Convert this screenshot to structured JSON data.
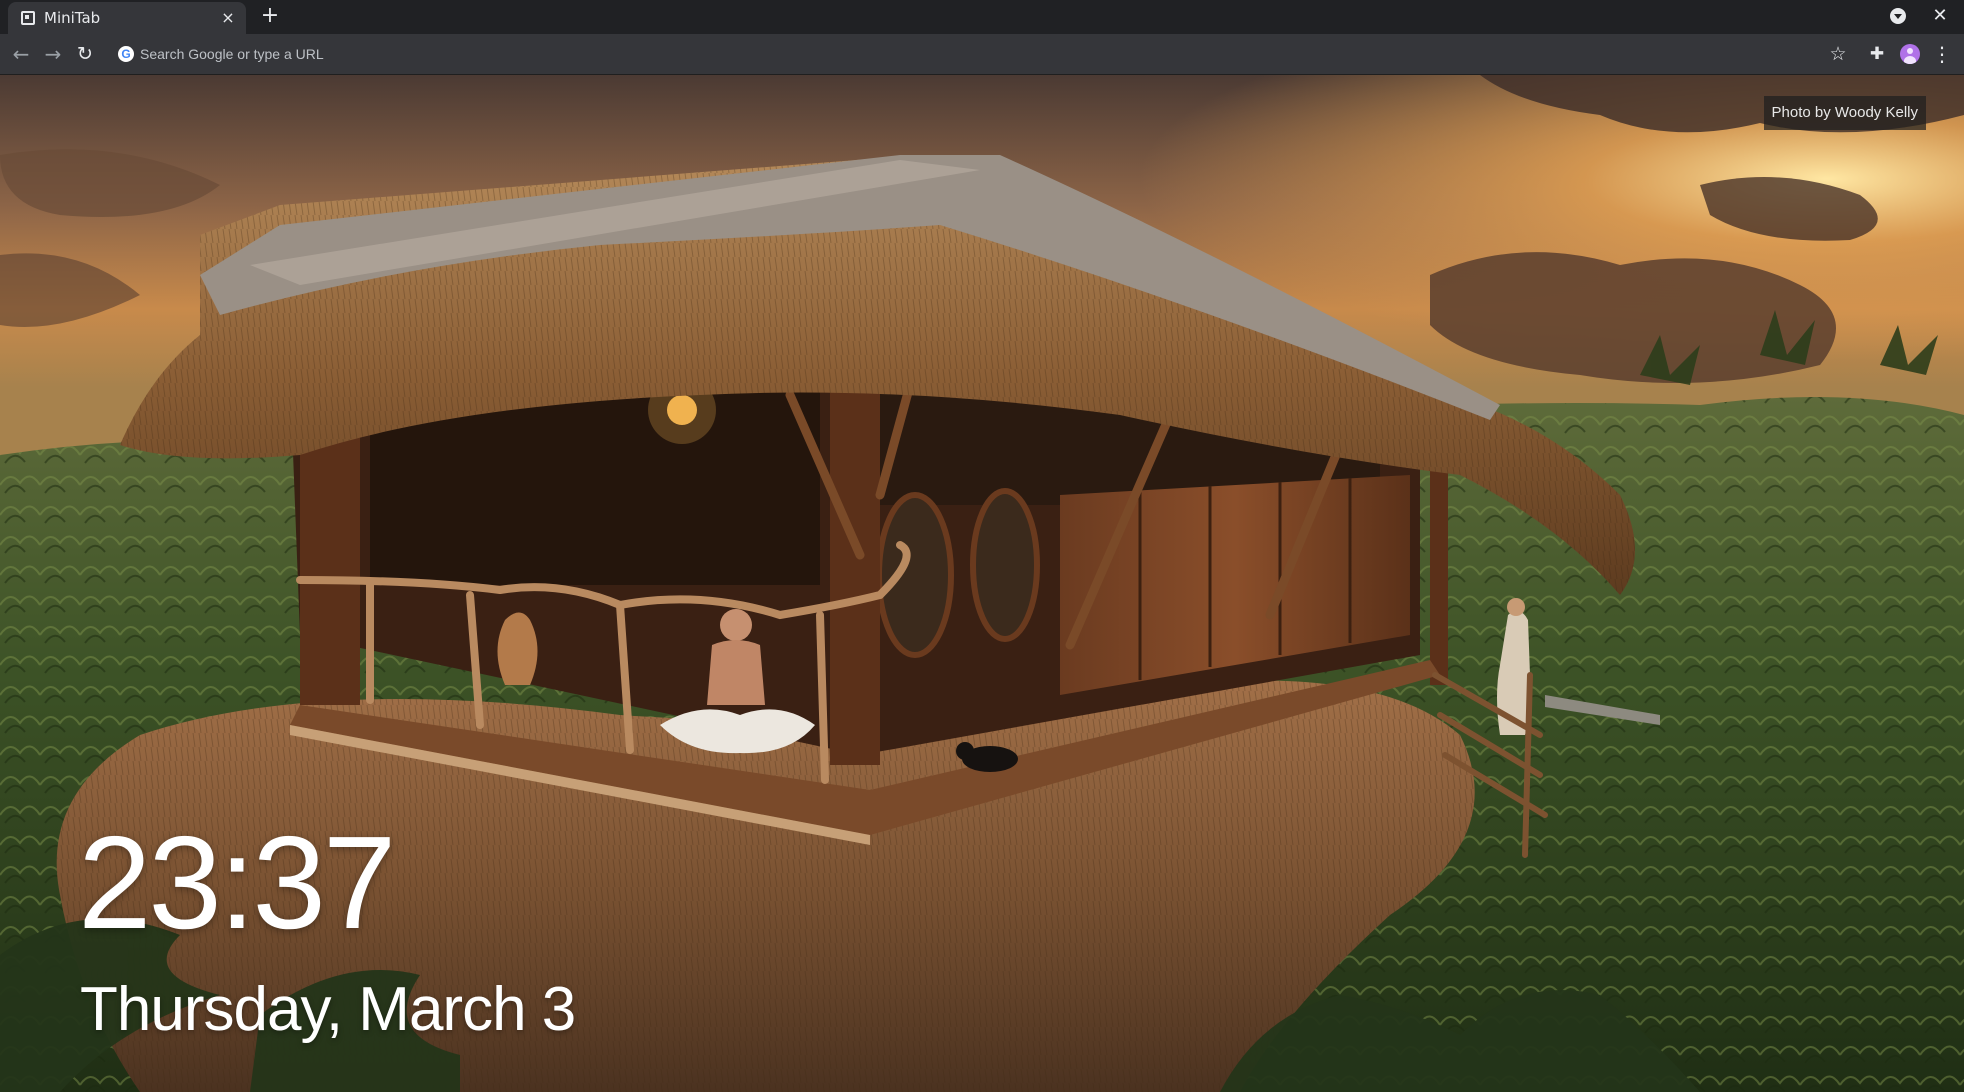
{
  "browser": {
    "tab": {
      "title": "MiniTab",
      "favicon": "minitab-icon",
      "close": "×"
    },
    "new_tab": "+",
    "window_close": "✕",
    "toolbar": {
      "back": "←",
      "forward": "→",
      "reload": "↻",
      "search_placeholder": "Search Google or type a URL",
      "search_value": "",
      "bookmark": "☆",
      "extensions": "✚",
      "menu": "⋮"
    }
  },
  "ntp": {
    "photo_credit": "Photo by Woody Kelly",
    "time": "23:37",
    "date": "Thursday, March 3",
    "background": "thatched-treehouse-at-sunset"
  },
  "colors": {
    "tabstrip": "#202124",
    "toolbar": "#35363a",
    "text": "#e8eaed",
    "avatar": "#b072e8"
  }
}
